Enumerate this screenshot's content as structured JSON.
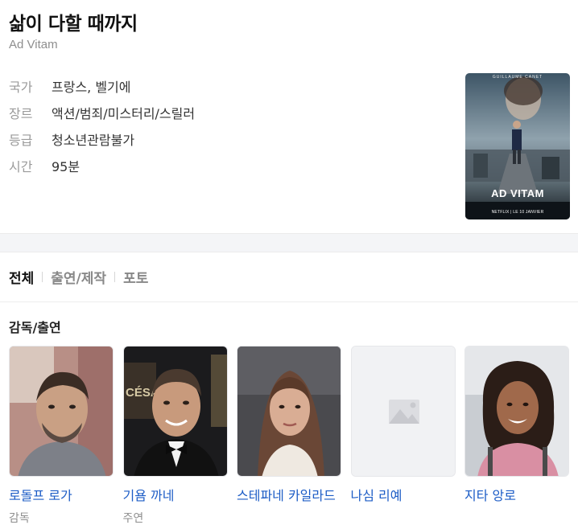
{
  "title": "삶이 다할 때까지",
  "original_title": "Ad Vitam",
  "info": [
    {
      "label": "국가",
      "value": "프랑스, 벨기에"
    },
    {
      "label": "장르",
      "value": "액션/범죄/미스터리/스릴러"
    },
    {
      "label": "등급",
      "value": "청소년관람불가"
    },
    {
      "label": "시간",
      "value": "95분"
    }
  ],
  "poster": {
    "top_text": "GUILLAUME CANET",
    "title": "AD VITAM",
    "bottom_text": "NETFLIX | LE 10 JANVIER"
  },
  "tabs": [
    "전체",
    "출연/제작",
    "포토"
  ],
  "section_title": "감독/출연",
  "people": [
    {
      "name": "로돌프 로가",
      "role": "감독"
    },
    {
      "name": "기욤 까네",
      "role": "주연"
    },
    {
      "name": "스테파네 카일라드",
      "role": ""
    },
    {
      "name": "나심 리예",
      "role": ""
    },
    {
      "name": "지타 앙로",
      "role": ""
    }
  ],
  "colors": {
    "link": "#1c5cc6",
    "muted": "#9a9a9a",
    "netflix": "#e50914"
  }
}
